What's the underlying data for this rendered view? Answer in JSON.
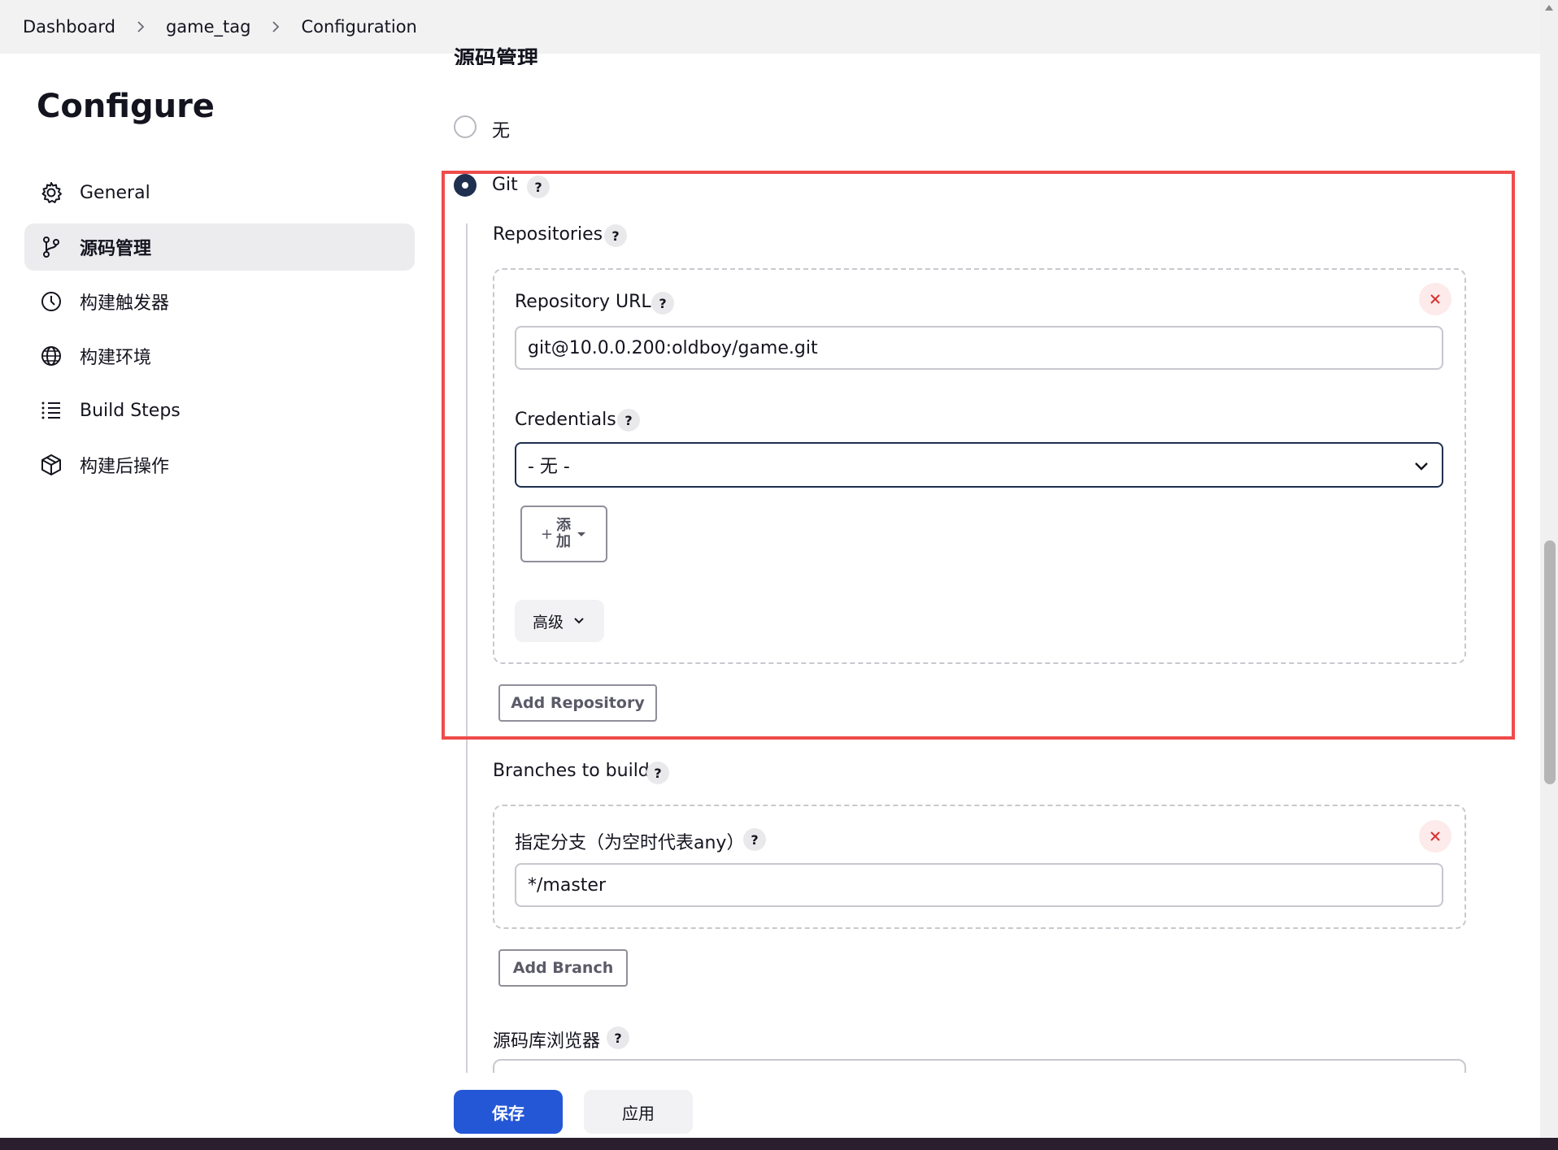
{
  "breadcrumb": [
    "Dashboard",
    "game_tag",
    "Configuration"
  ],
  "sidebar": {
    "title": "Configure",
    "items": [
      {
        "label": "General",
        "icon": "gear-icon",
        "active": false
      },
      {
        "label": "源码管理",
        "icon": "branch-icon",
        "active": true
      },
      {
        "label": "构建触发器",
        "icon": "clock-icon",
        "active": false
      },
      {
        "label": "构建环境",
        "icon": "globe-icon",
        "active": false
      },
      {
        "label": "Build Steps",
        "icon": "list-icon",
        "active": false
      },
      {
        "label": "构建后操作",
        "icon": "package-icon",
        "active": false
      }
    ]
  },
  "scm": {
    "section_title": "源码管理",
    "option_none": "无",
    "option_git": "Git",
    "help": "?",
    "repositories_label": "Repositories",
    "repo_url_label": "Repository URL",
    "repo_url_value": "git@10.0.0.200:oldboy/game.git",
    "credentials_label": "Credentials",
    "credentials_value": "- 无 -",
    "add_cred_line1": "添",
    "add_cred_line2": "加",
    "add_cred_plus": "+",
    "advanced_label": "高级",
    "add_repository": "Add Repository",
    "branches_label": "Branches to build",
    "branch_spec_label": "指定分支（为空时代表any）",
    "branch_spec_value": "*/master",
    "add_branch": "Add Branch",
    "browser_label": "源码库浏览器"
  },
  "footer": {
    "save": "保存",
    "apply": "应用"
  },
  "colors": {
    "accent": "#2457d6",
    "highlight": "#ef4b4b",
    "radio": "#1f2f4f"
  }
}
